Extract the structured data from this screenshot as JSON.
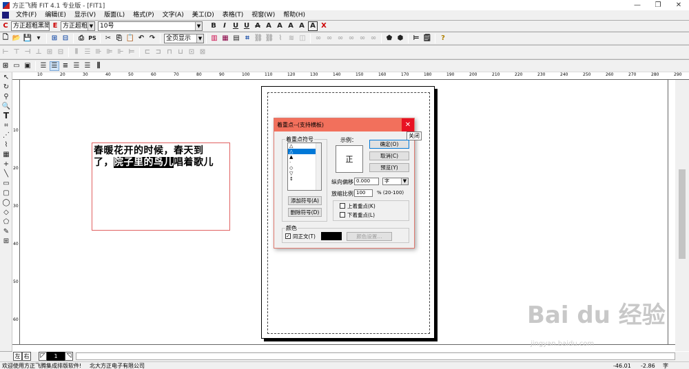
{
  "window": {
    "title": "方正飞腾 FIT 4.1 专业版 - [FIT1]"
  },
  "menu": [
    "文件(F)",
    "编辑(E)",
    "显示(V)",
    "版面(L)",
    "格式(P)",
    "文字(A)",
    "美工(D)",
    "表格(T)",
    "视窗(W)",
    "帮助(H)"
  ],
  "format_bar": {
    "c_font": "方正超粗黑简体",
    "e_font": "方正超粗",
    "size": "10号",
    "style_icons": [
      "B",
      "I",
      "U",
      "U",
      "A",
      "A",
      "A",
      "A",
      "A",
      "A",
      "X"
    ]
  },
  "toolbar": {
    "zoom": "全页显示"
  },
  "document": {
    "line1": "春暖花开的时候，春天到",
    "line2_a": "了，",
    "line2_b": "院子里的鸟儿",
    "line2_c": "唱着歌儿"
  },
  "dialog": {
    "title": "着重点--(支持横板)",
    "close_tooltip": "关闭",
    "symbol_group": "着重点符号",
    "symbols": [
      "△",
      "△",
      "▲",
      "·",
      "◇",
      "▽",
      "↕"
    ],
    "sample_label": "示例：",
    "sample_char": "正",
    "ok": "确定(O)",
    "cancel": "取消(C)",
    "preview": "预览(Y)",
    "offset_label": "纵向偏移",
    "offset_value": "0.000",
    "offset_unit": "字",
    "scale_label": "放缩比例",
    "scale_value": "100",
    "scale_hint": "% (20-100)",
    "add_symbol": "添加符号(A)",
    "delete_symbol": "删除符号(D)",
    "above": "上着重点(K)",
    "below": "下着重点(L)",
    "color_group": "颜色",
    "same_as_text": "同正文(T)",
    "color_settings": "颜色设置..."
  },
  "rulers": {
    "h": [
      "10",
      "20",
      "30",
      "40",
      "50",
      "60",
      "70",
      "80",
      "90",
      "100",
      "110",
      "120",
      "130",
      "140",
      "150",
      "160",
      "170",
      "180",
      "190",
      "200",
      "210",
      "220",
      "230",
      "240",
      "250",
      "260",
      "270",
      "280",
      "290"
    ],
    "v": [
      "10",
      "20",
      "30",
      "40",
      "50",
      "60"
    ]
  },
  "bottom": {
    "left_btn": "左",
    "right_btn": "右",
    "page": "1"
  },
  "status": {
    "welcome": "欢迎使用方正飞腾集成排版软件!",
    "company": "北大方正电子有限公司",
    "x": "-46.01",
    "y": "-2.86",
    "unit": "字"
  },
  "watermark": {
    "brand": "Bai du 经验",
    "url": "jingyan.baidu.com"
  }
}
